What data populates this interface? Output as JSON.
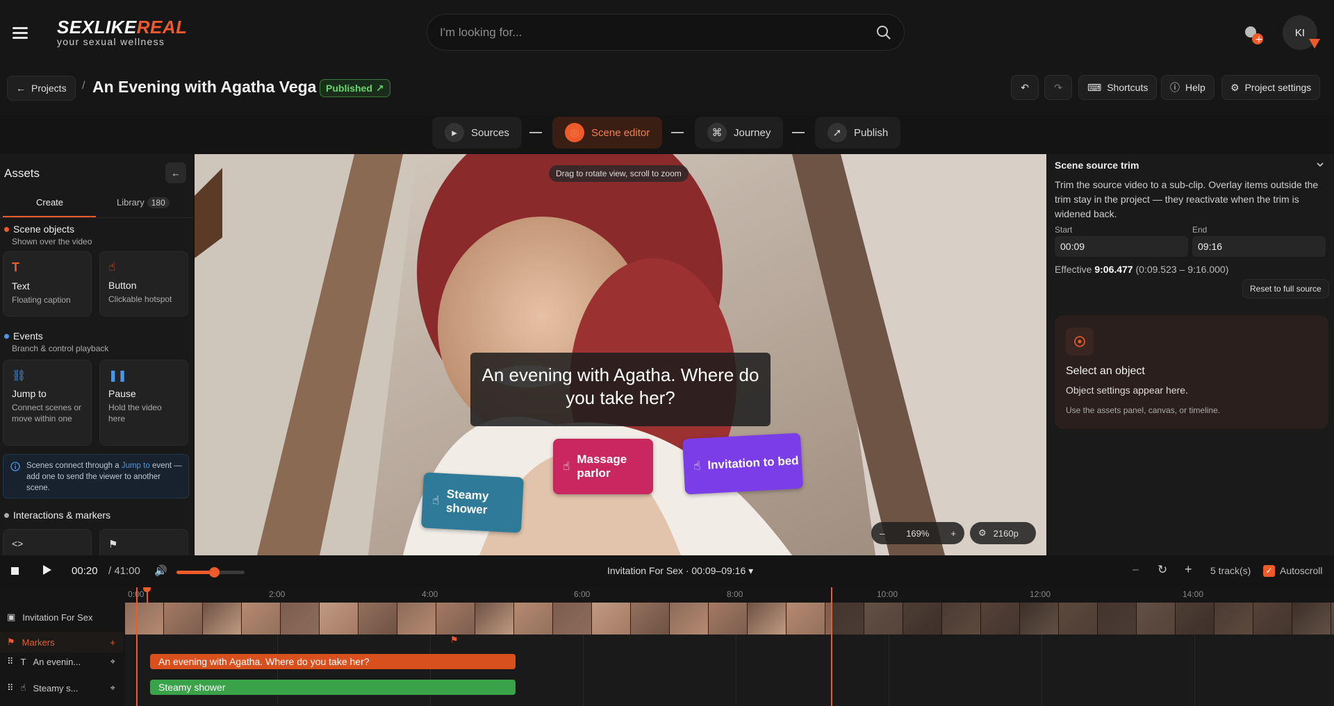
{
  "header": {
    "logo_main": "SEXLIKE",
    "logo_accent": "REAL",
    "logo_tagline": "your sexual wellness",
    "search_placeholder": "I'm looking for...",
    "avatar_initials": "KI"
  },
  "project": {
    "back_label": "Projects",
    "separator": "/",
    "title": "An Evening with Agatha Vega",
    "status": "Published",
    "shortcuts_label": "Shortcuts",
    "help_label": "Help",
    "settings_label": "Project settings"
  },
  "steps": [
    {
      "label": "Sources",
      "active": false
    },
    {
      "label": "Scene editor",
      "active": true
    },
    {
      "label": "Journey",
      "active": false
    },
    {
      "label": "Publish",
      "active": false
    }
  ],
  "assets": {
    "title": "Assets",
    "tab_create": "Create",
    "tab_library": "Library",
    "library_count": "180",
    "scene_objects_title": "Scene objects",
    "scene_objects_sub": "Shown over the video",
    "text_card_title": "Text",
    "text_card_desc": "Floating caption",
    "button_card_title": "Button",
    "button_card_desc": "Clickable hotspot",
    "events_title": "Events",
    "events_sub": "Branch & control playback",
    "jump_card_title": "Jump to",
    "jump_card_desc": "Connect scenes or move within one",
    "pause_card_title": "Pause",
    "pause_card_desc": "Hold the video here",
    "info_pre": "Scenes connect through a ",
    "info_link": "Jump to",
    "info_post": " event — add one to send the viewer to another scene.",
    "interactions_title": "Interactions & markers"
  },
  "viewer": {
    "tip": "Drag to rotate view, scroll to zoom",
    "caption": "An evening with Agatha. Where do you take her?",
    "hotspots": [
      "Steamy shower",
      "Massage parlor",
      "Invitation to bed"
    ],
    "zoom": "169%",
    "resolution": "2160p"
  },
  "trim": {
    "title": "Scene source trim",
    "description": "Trim the source video to a sub-clip. Overlay items outside the trim stay in the project — they reactivate when the trim is widened back.",
    "start_label": "Start",
    "end_label": "End",
    "start_value": "00:09",
    "end_value": "09:16",
    "effective_label": "Effective",
    "effective_value": "9:06.477",
    "effective_range": "(0:09.523 – 9:16.000)",
    "reset_label": "Reset to full source"
  },
  "select_panel": {
    "heading": "Select an object",
    "text": "Object settings appear here.",
    "hint": "Use the assets panel, canvas, or timeline."
  },
  "transport": {
    "current_time": "00:20",
    "total_time": "/ 41:00",
    "volume": 0.55,
    "clip_label": "Invitation For Sex · 00:09–09:16",
    "track_count": "5 track(s)",
    "autoscroll_label": "Autoscroll"
  },
  "timeline": {
    "ruler_ticks": [
      "0:00",
      "2:00",
      "4:00",
      "6:00",
      "8:00",
      "10:00",
      "12:00",
      "14:00"
    ],
    "tracks": [
      {
        "label": "Invitation For Sex"
      },
      {
        "label": "Markers"
      },
      {
        "label": "An evenin..."
      },
      {
        "label": "Steamy s..."
      }
    ],
    "segments": [
      "An evening with Agatha. Where do you take her?",
      "Steamy shower"
    ]
  },
  "colors": {
    "accent": "#ee5a2a",
    "shower": "#2f7a98",
    "massage": "#c8285f",
    "bed": "#7b3de8",
    "green_segment": "#3aa34a"
  }
}
